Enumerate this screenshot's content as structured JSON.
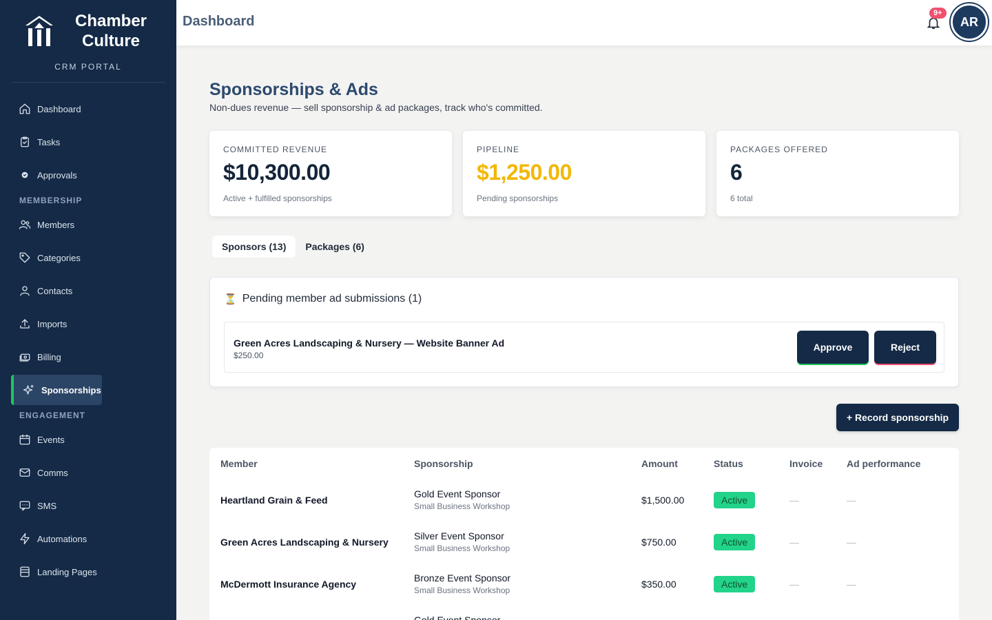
{
  "app": {
    "brand_name": "Chamber Culture",
    "brand_sub": "CRM PORTAL",
    "topbar_title": "Dashboard",
    "notification_badge": "9+",
    "avatar_initials": "AR"
  },
  "sidebar": {
    "items_top": [
      {
        "label": "Dashboard",
        "icon": "home-icon"
      },
      {
        "label": "Tasks",
        "icon": "clipboard-icon"
      },
      {
        "label": "Approvals",
        "icon": "check-circle-icon"
      }
    ],
    "section_membership": "MEMBERSHIP",
    "items_membership": [
      {
        "label": "Members",
        "icon": "users-icon"
      },
      {
        "label": "Categories",
        "icon": "tag-icon"
      },
      {
        "label": "Contacts",
        "icon": "user-icon"
      },
      {
        "label": "Imports",
        "icon": "upload-icon"
      },
      {
        "label": "Billing",
        "icon": "cash-icon"
      },
      {
        "label": "Sponsorships",
        "icon": "sparkle-icon",
        "active": true
      }
    ],
    "section_engagement": "ENGAGEMENT",
    "items_engagement": [
      {
        "label": "Events",
        "icon": "calendar-icon"
      },
      {
        "label": "Comms",
        "icon": "mail-icon"
      },
      {
        "label": "SMS",
        "icon": "message-icon"
      },
      {
        "label": "Automations",
        "icon": "bolt-icon"
      },
      {
        "label": "Landing Pages",
        "icon": "layout-icon"
      }
    ]
  },
  "page": {
    "title": "Sponsorships & Ads",
    "subtitle": "Non-dues revenue — sell sponsorship & ad packages, track who's committed."
  },
  "stats": [
    {
      "label": "COMMITTED REVENUE",
      "value": "$10,300.00",
      "note": "Active + fulfilled sponsorships"
    },
    {
      "label": "PIPELINE",
      "value": "$1,250.00",
      "note": "Pending sponsorships"
    },
    {
      "label": "PACKAGES OFFERED",
      "value": "6",
      "note": "6 total"
    }
  ],
  "tabs": [
    {
      "label": "Sponsors (13)",
      "active": true
    },
    {
      "label": "Packages (6)",
      "active": false
    }
  ],
  "pending": {
    "title": "Pending member ad submissions (1)",
    "item_name": "Green Acres Landscaping & Nursery — Website Banner Ad",
    "item_amount": "$250.00",
    "approve_label": "Approve",
    "reject_label": "Reject"
  },
  "record_button_label": "+ Record sponsorship",
  "table": {
    "columns": [
      "Member",
      "Sponsorship",
      "Amount",
      "Status",
      "Invoice",
      "Ad performance"
    ],
    "rows": [
      {
        "member": "Heartland Grain & Feed",
        "sponsorship": "Gold Event Sponsor",
        "event": "Small Business Workshop",
        "amount": "$1,500.00",
        "status": "Active",
        "invoice": "—",
        "ad_performance": "—"
      },
      {
        "member": "Green Acres Landscaping & Nursery",
        "sponsorship": "Silver Event Sponsor",
        "event": "Small Business Workshop",
        "amount": "$750.00",
        "status": "Active",
        "invoice": "—",
        "ad_performance": "—"
      },
      {
        "member": "McDermott Insurance Agency",
        "sponsorship": "Bronze Event Sponsor",
        "event": "Small Business Workshop",
        "amount": "$350.00",
        "status": "Active",
        "invoice": "—",
        "ad_performance": "—"
      },
      {
        "member": "",
        "sponsorship": "Gold Event Sponsor",
        "event": "",
        "amount": "",
        "status": "",
        "invoice": "",
        "ad_performance": ""
      }
    ]
  },
  "colors": {
    "sidebar_bg": "#142a46",
    "accent_green": "#22c55e",
    "pipeline_gold": "#f2b705",
    "badge_red": "#f0506e"
  }
}
